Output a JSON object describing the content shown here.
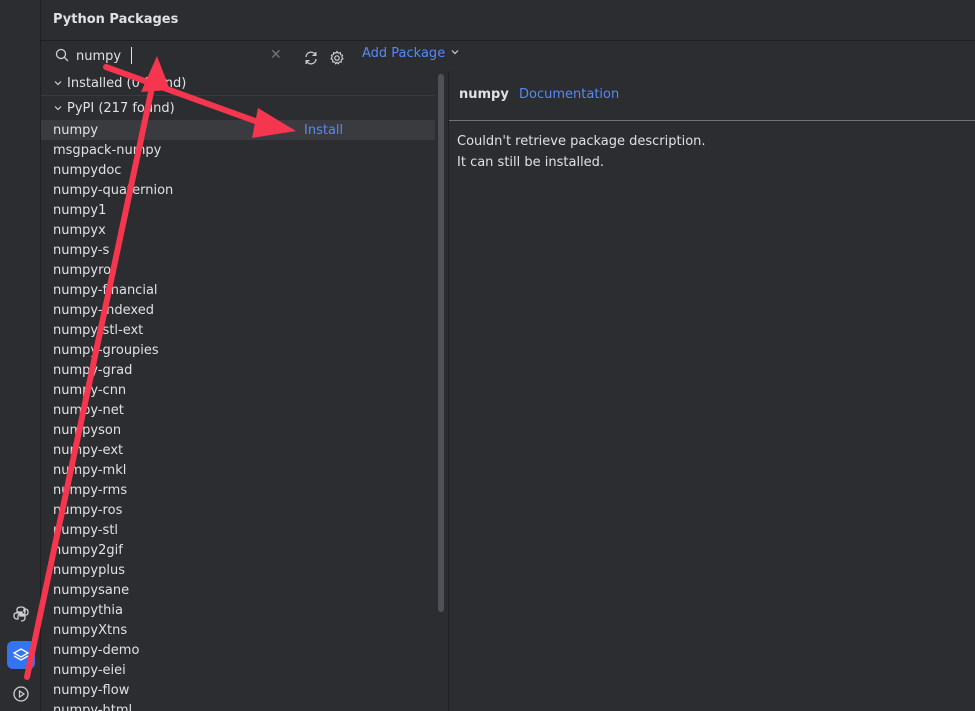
{
  "panel": {
    "title": "Python Packages"
  },
  "search": {
    "value": "numpy",
    "placeholder": ""
  },
  "toolbar": {
    "add_package_label": "Add Package"
  },
  "groups": {
    "installed_label": "Installed (0 found)",
    "pypi_label": "PyPI (217 found)"
  },
  "packages": [
    "numpy",
    "msgpack-numpy",
    "numpydoc",
    "numpy-quaternion",
    "numpy1",
    "numpyx",
    "numpy-s",
    "numpyro",
    "numpy-financial",
    "numpy-indexed",
    "numpy-stl-ext",
    "numpy-groupies",
    "numpy-grad",
    "numpy-cnn",
    "numpy-net",
    "numpyson",
    "numpy-ext",
    "numpy-mkl",
    "numpy-rms",
    "numpy-ros",
    "numpy-stl",
    "numpy2gif",
    "numpyplus",
    "numpysane",
    "numpythia",
    "numpyXtns",
    "numpy-demo",
    "numpy-eiei",
    "numpy-flow",
    "numpy-html"
  ],
  "selected_row": {
    "install_label": "Install"
  },
  "detail": {
    "package_name": "numpy",
    "doc_link": "Documentation",
    "desc_line1": "Couldn't retrieve package description.",
    "desc_line2": "It can still be installed."
  },
  "colors": {
    "accent": "#548af7",
    "annotation_arrow": "#f5364e",
    "active_tool": "#3574f0"
  },
  "icons": {
    "python": "python-icon",
    "packages": "layers-icon",
    "run": "play-circle-icon"
  }
}
